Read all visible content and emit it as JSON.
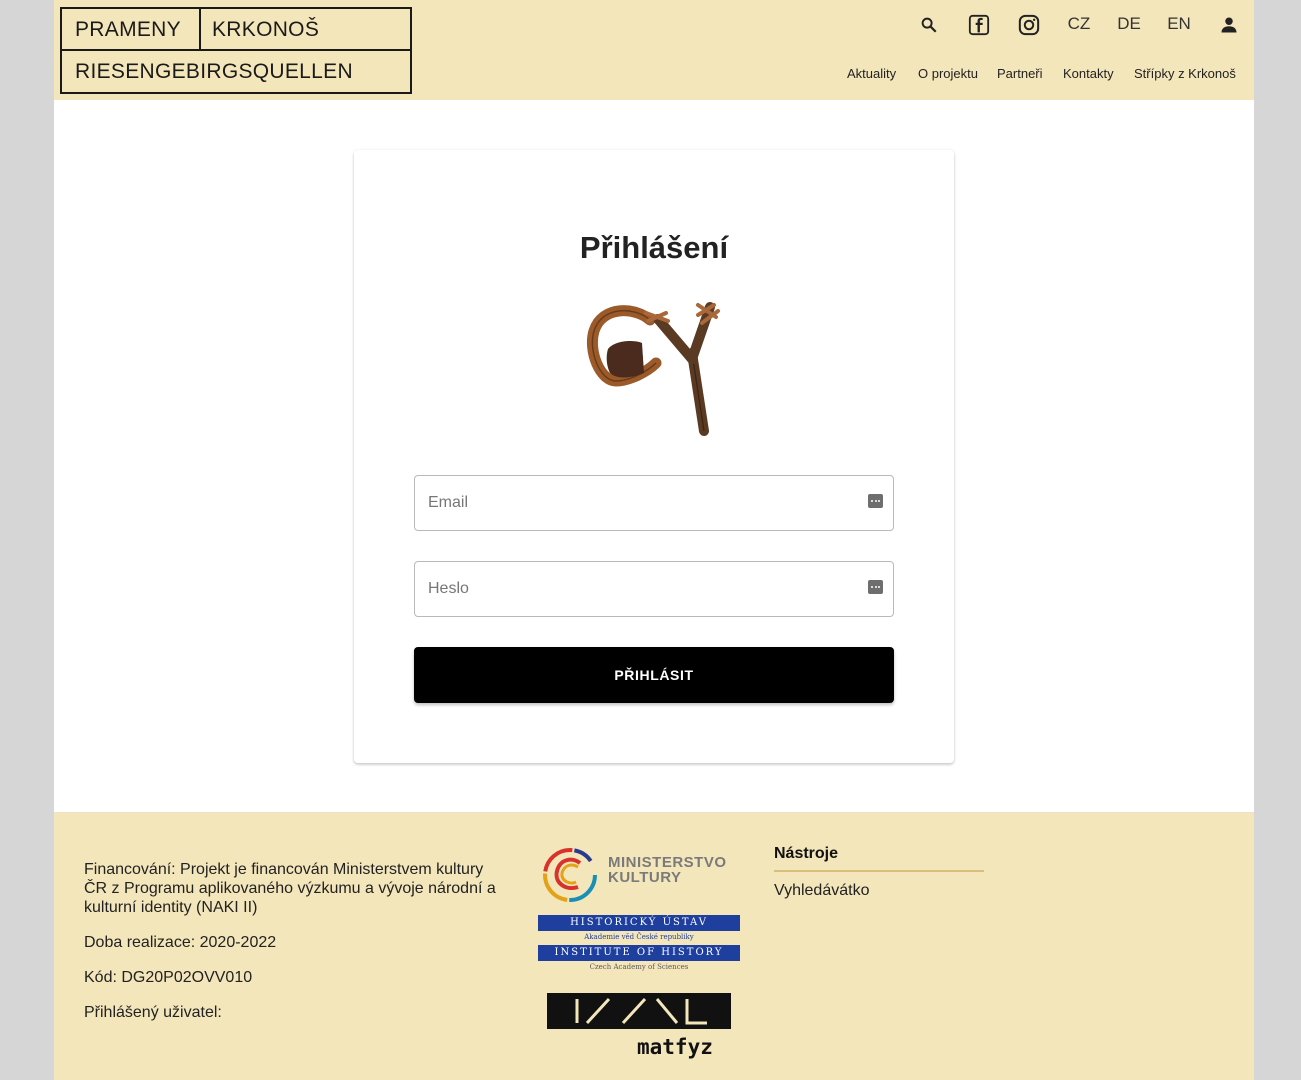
{
  "header": {
    "logo": {
      "line1_left": "PRAMENY",
      "line1_right": "KRKONOŠ",
      "line2": "RIESENGEBIRGSQUELLEN"
    },
    "icons": [
      "search-icon",
      "facebook-icon",
      "instagram-icon",
      "user-icon"
    ],
    "languages": [
      "CZ",
      "DE",
      "EN"
    ],
    "nav": [
      "Aktuality",
      "O projektu",
      "Partneři",
      "Kontakty",
      "Střípky z Krkonoš"
    ]
  },
  "login": {
    "title": "Přihlášení",
    "email_placeholder": "Email",
    "password_placeholder": "Heslo",
    "submit_label": "PŘIHLÁSIT"
  },
  "footer": {
    "funding": "Financování: Projekt je financován Ministerstvem kultury ČR z Programu aplikovaného výzkumu a vývoje národní a kulturní identity (NAKI II)",
    "period": "Doba realizace: 2020-2022",
    "code": "Kód: DG20P02OVV010",
    "logged_user": "Přihlášený uživatel:",
    "tools_title": "Nástroje",
    "tools_link": "Vyhledávátko",
    "logos": {
      "ministry_line1": "MINISTERSTVO",
      "ministry_line2": "KULTURY",
      "history_line1": "HISTORICKÝ ÚSTAV",
      "history_sub1": "Akademie věd České republiky",
      "history_line2": "INSTITUTE OF HISTORY",
      "history_sub2": "Czech Academy of Sciences",
      "matfyz": "matfyz"
    }
  },
  "colors": {
    "header_bg": "#f4e6bb",
    "footer_bg": "#f4e6bb",
    "button_bg": "#000000",
    "accent_line": "#d8bf7b"
  }
}
